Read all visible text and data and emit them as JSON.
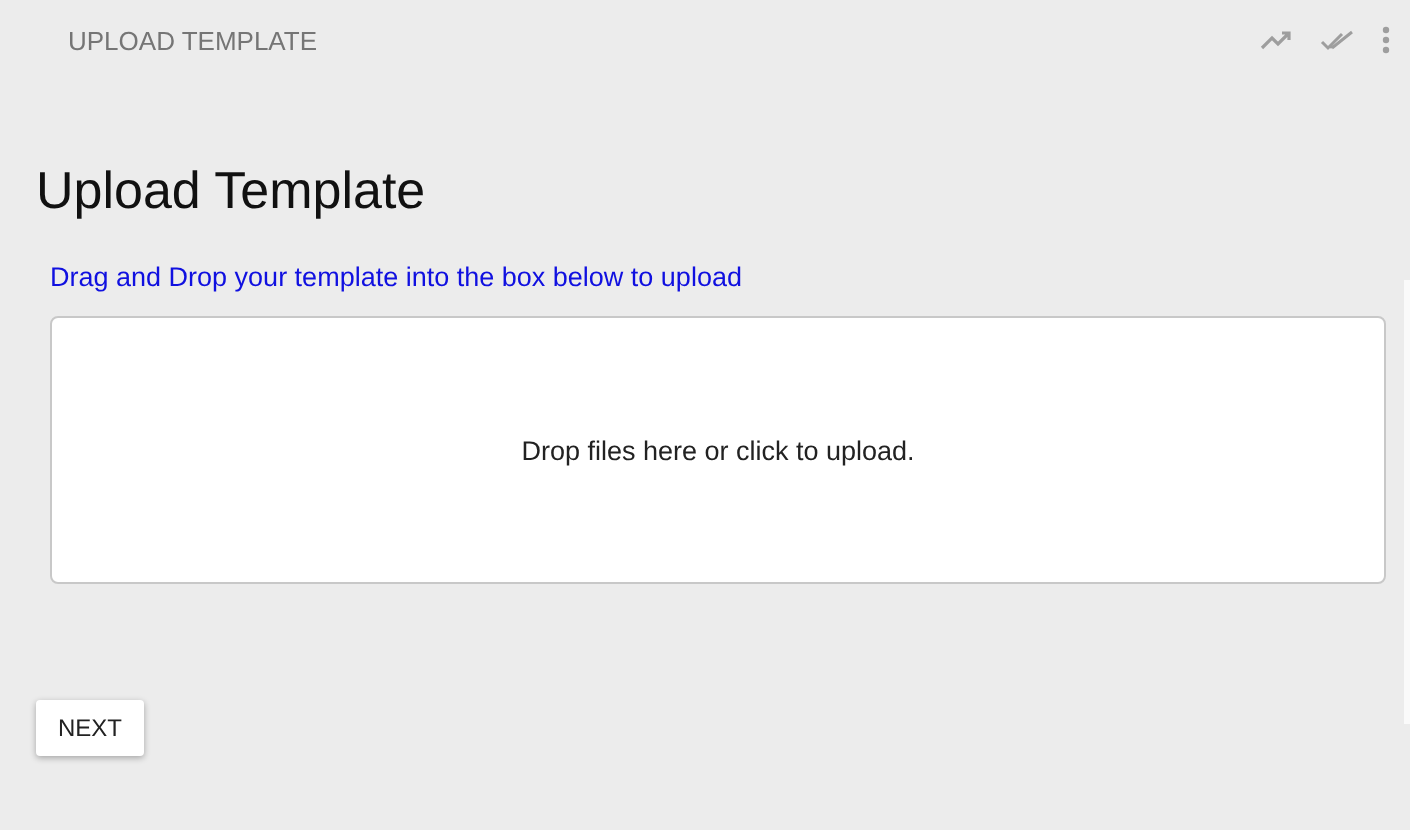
{
  "toolbar": {
    "title": "UPLOAD TEMPLATE"
  },
  "heading": "Upload Template",
  "instructions": "Drag and Drop your template into the box below to upload",
  "dropzone": {
    "text": "Drop files here or click to upload."
  },
  "buttons": [
    {
      "label": "NEXT"
    }
  ]
}
